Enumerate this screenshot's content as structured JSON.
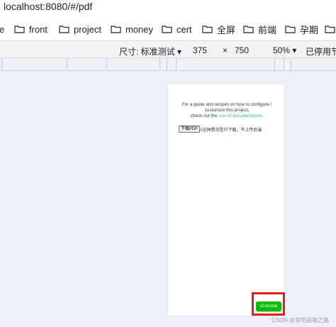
{
  "browser": {
    "url": "localhost:8080/#/pdf",
    "bookmarks": [
      {
        "label": "e",
        "has_icon": false
      },
      {
        "label": "front",
        "has_icon": true
      },
      {
        "label": "project",
        "has_icon": true
      },
      {
        "label": "money",
        "has_icon": true
      },
      {
        "label": "cert",
        "has_icon": true
      },
      {
        "label": "全屏",
        "has_icon": true
      },
      {
        "label": "前端",
        "has_icon": true
      },
      {
        "label": "孕期",
        "has_icon": true
      },
      {
        "label": "",
        "has_icon": true
      }
    ]
  },
  "devtools": {
    "device_label": "尺寸: 标准测试 ▾",
    "width": "375",
    "times": "×",
    "height": "750",
    "zoom": "50% ▾",
    "throttle": "已停用节"
  },
  "page": {
    "intro_line1": "For a guide and recipes on how to configure /",
    "intro_line2": "customize this project,",
    "intro_line3_prefix": "check out the ",
    "intro_link": "vue-cli documentation",
    "intro_line3_suffix": ".",
    "download_button": "下载PDF",
    "download_note": "//这种情况是只下载，不上传后端",
    "vconsole_button": "vConsole"
  },
  "watermark": "CSDN @贪吃前端之路",
  "colors": {
    "link": "#42b983",
    "vconsole": "#04be02",
    "highlight": "#e0201b"
  }
}
